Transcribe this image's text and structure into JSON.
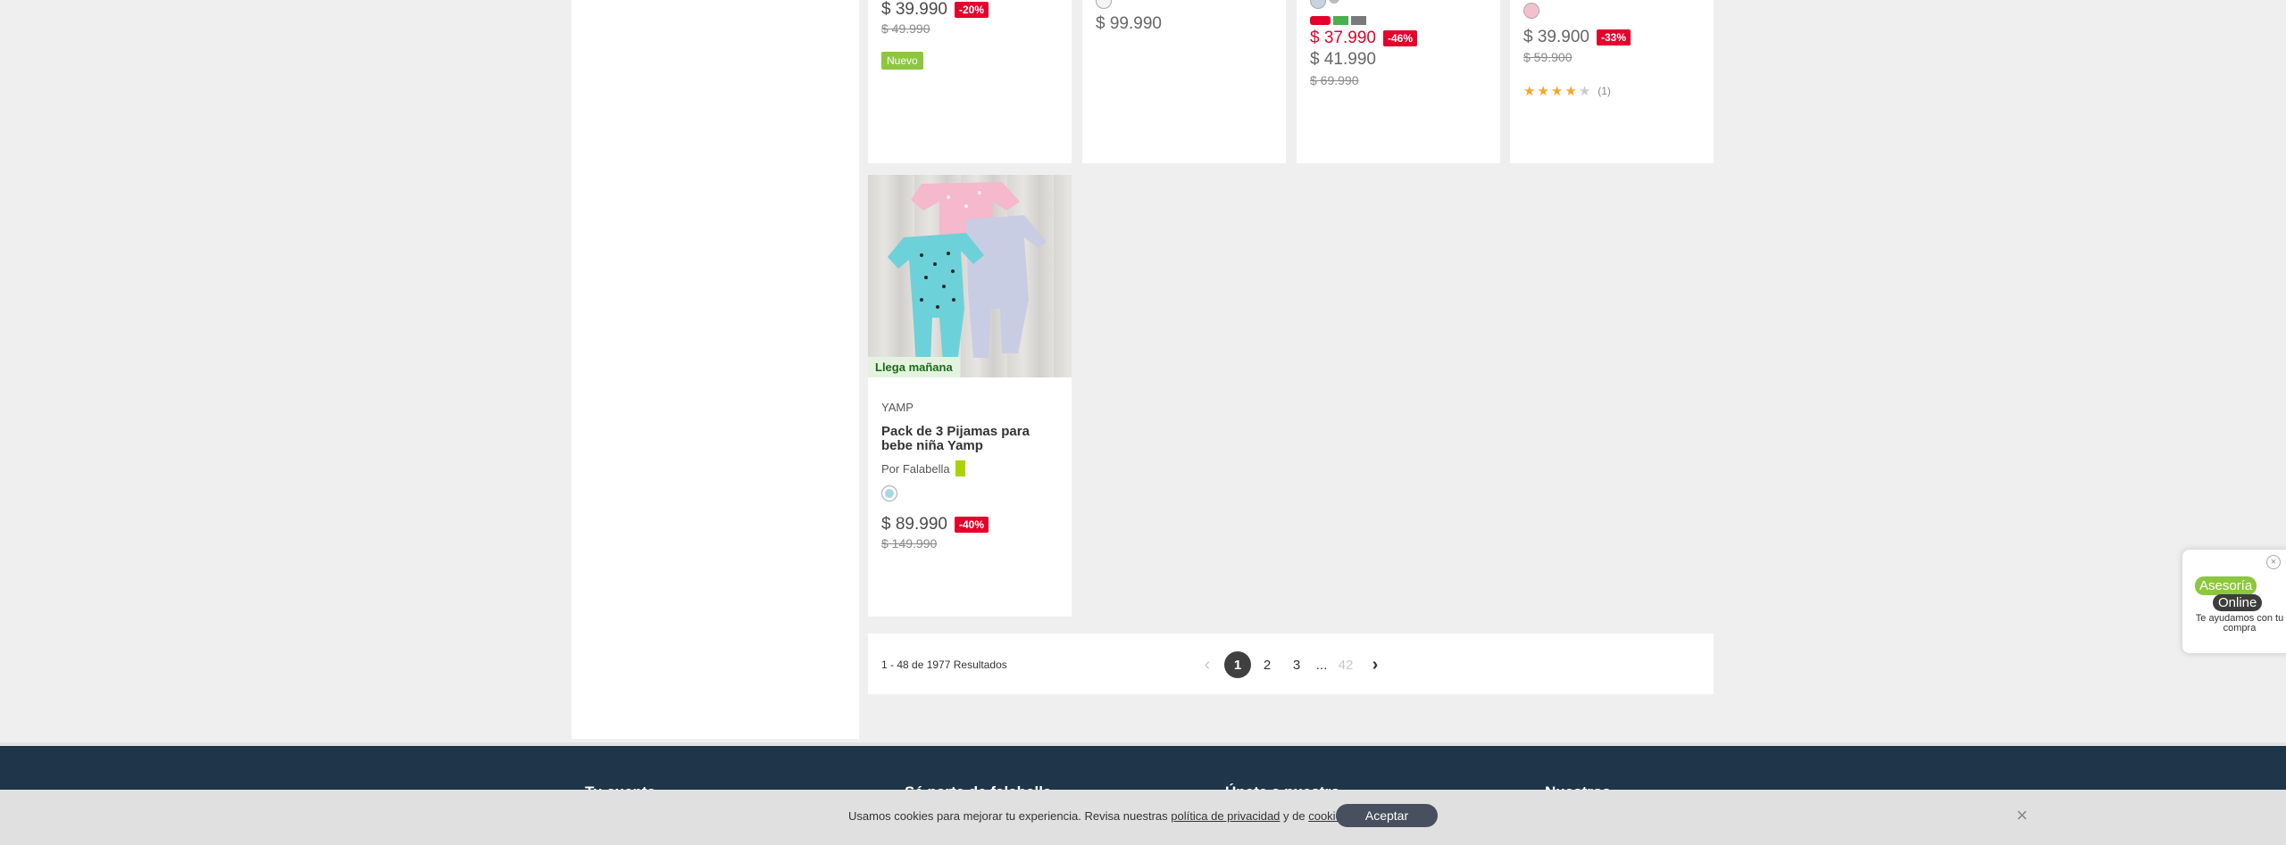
{
  "products_top": [
    {
      "price": "$ 39.990",
      "discount": "-20%",
      "old_price": "$ 49.990",
      "badge": "Nuevo"
    },
    {
      "price": "$ 99.990"
    },
    {
      "price": "$ 37.990",
      "discount": "-46%",
      "price2": "$ 41.990",
      "old_price": "$ 69.990"
    },
    {
      "price": "$ 39.900",
      "discount": "-33%",
      "old_price": "$ 59.900",
      "rating": 4,
      "rating_count": "(1)"
    }
  ],
  "product_main": {
    "delivery_badge": "Llega mañana",
    "brand": "YAMP",
    "name": "Pack de 3 Pijamas para bebe niña Yamp",
    "seller": "Por Falabella",
    "price": "$ 89.990",
    "discount": "-40%",
    "old_price": "$ 149.990"
  },
  "pagination": {
    "results": "1 - 48 de 1977 Resultados",
    "pages": [
      "1",
      "2",
      "3"
    ],
    "ellipsis": "...",
    "last": "42"
  },
  "footer": {
    "headings": [
      "Tu cuenta",
      "Sé parte de falabella",
      "Únete a nuestro...",
      "Nuestros..."
    ]
  },
  "cookie": {
    "text_before": "Usamos cookies para mejorar tu experiencia. Revisa nuestras ",
    "privacy_link": "política de privacidad",
    "text_mid": " y de ",
    "cookies_link": "cookies",
    "text_end": ".",
    "accept": "Aceptar"
  },
  "chat": {
    "line1": "Asesoría",
    "line2": "Online",
    "subtitle": "Te ayudamos con tu compra"
  }
}
